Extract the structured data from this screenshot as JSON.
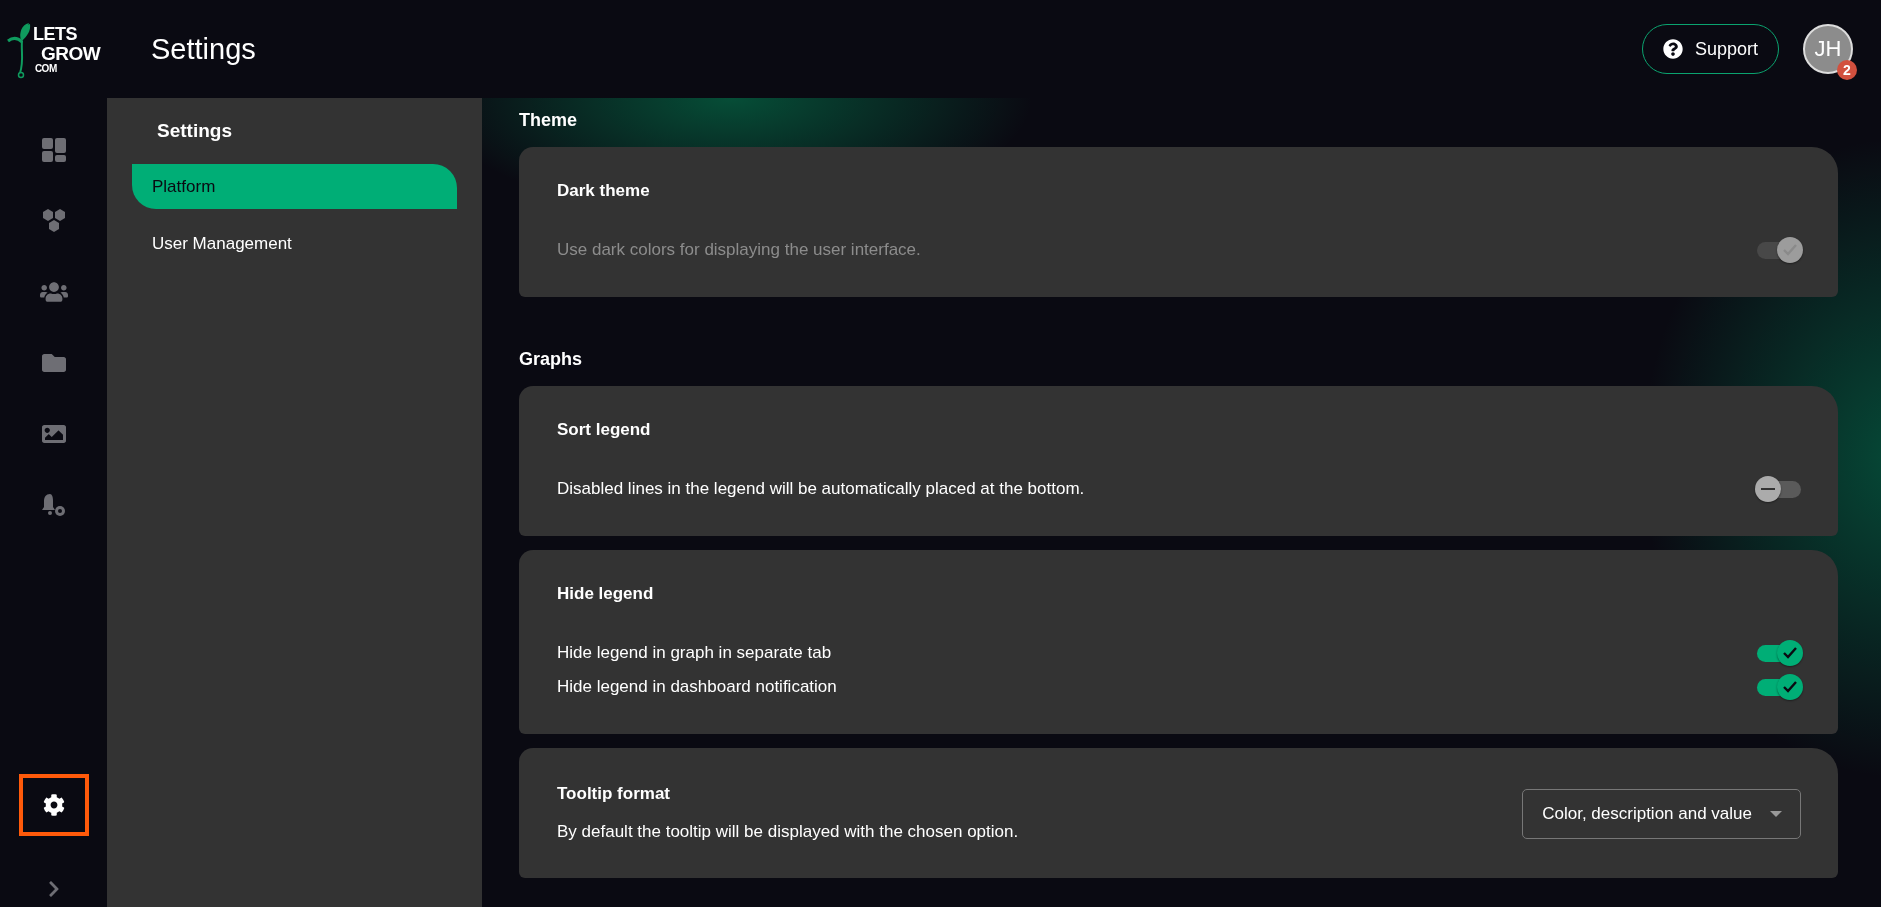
{
  "logo": {
    "line1": "LETS",
    "line2": "GROW",
    "line3": "COM"
  },
  "header": {
    "title": "Settings",
    "support_label": "Support",
    "avatar": {
      "initials": "JH",
      "badge": "2"
    }
  },
  "nav_rail": {
    "items": [
      {
        "kind": "dashboard",
        "selected": false
      },
      {
        "kind": "hexagons",
        "selected": false
      },
      {
        "kind": "users",
        "selected": false
      },
      {
        "kind": "folder",
        "selected": false
      },
      {
        "kind": "image",
        "selected": false
      },
      {
        "kind": "bell-settings",
        "selected": false
      },
      {
        "kind": "settings",
        "selected": true
      },
      {
        "kind": "expand",
        "selected": false
      }
    ]
  },
  "settings_menu": {
    "title": "Settings",
    "items": [
      {
        "label": "Platform",
        "selected": true
      },
      {
        "label": "User Management",
        "selected": false
      }
    ]
  },
  "sections": [
    {
      "title": "Theme",
      "cards": [
        {
          "title": "Dark theme",
          "rows": [
            {
              "kind": "toggle",
              "label": "Use dark colors for displaying the user interface.",
              "checked": true,
              "disabled": true
            }
          ]
        }
      ]
    },
    {
      "title": "Graphs",
      "cards": [
        {
          "title": "Sort legend",
          "rows": [
            {
              "kind": "toggle",
              "label": "Disabled lines in the legend will be automatically placed at the bottom.",
              "checked": false,
              "disabled": false
            }
          ]
        },
        {
          "title": "Hide legend",
          "rows": [
            {
              "kind": "toggle",
              "label": "Hide legend in graph in separate tab",
              "checked": true,
              "disabled": false
            },
            {
              "kind": "toggle",
              "label": "Hide legend in dashboard notification",
              "checked": true,
              "disabled": false
            }
          ]
        },
        {
          "title": "Tooltip format",
          "rows": [
            {
              "kind": "select",
              "label": "By default the tooltip will be displayed with the chosen option.",
              "value": "Color, description and value"
            }
          ]
        }
      ]
    }
  ]
}
